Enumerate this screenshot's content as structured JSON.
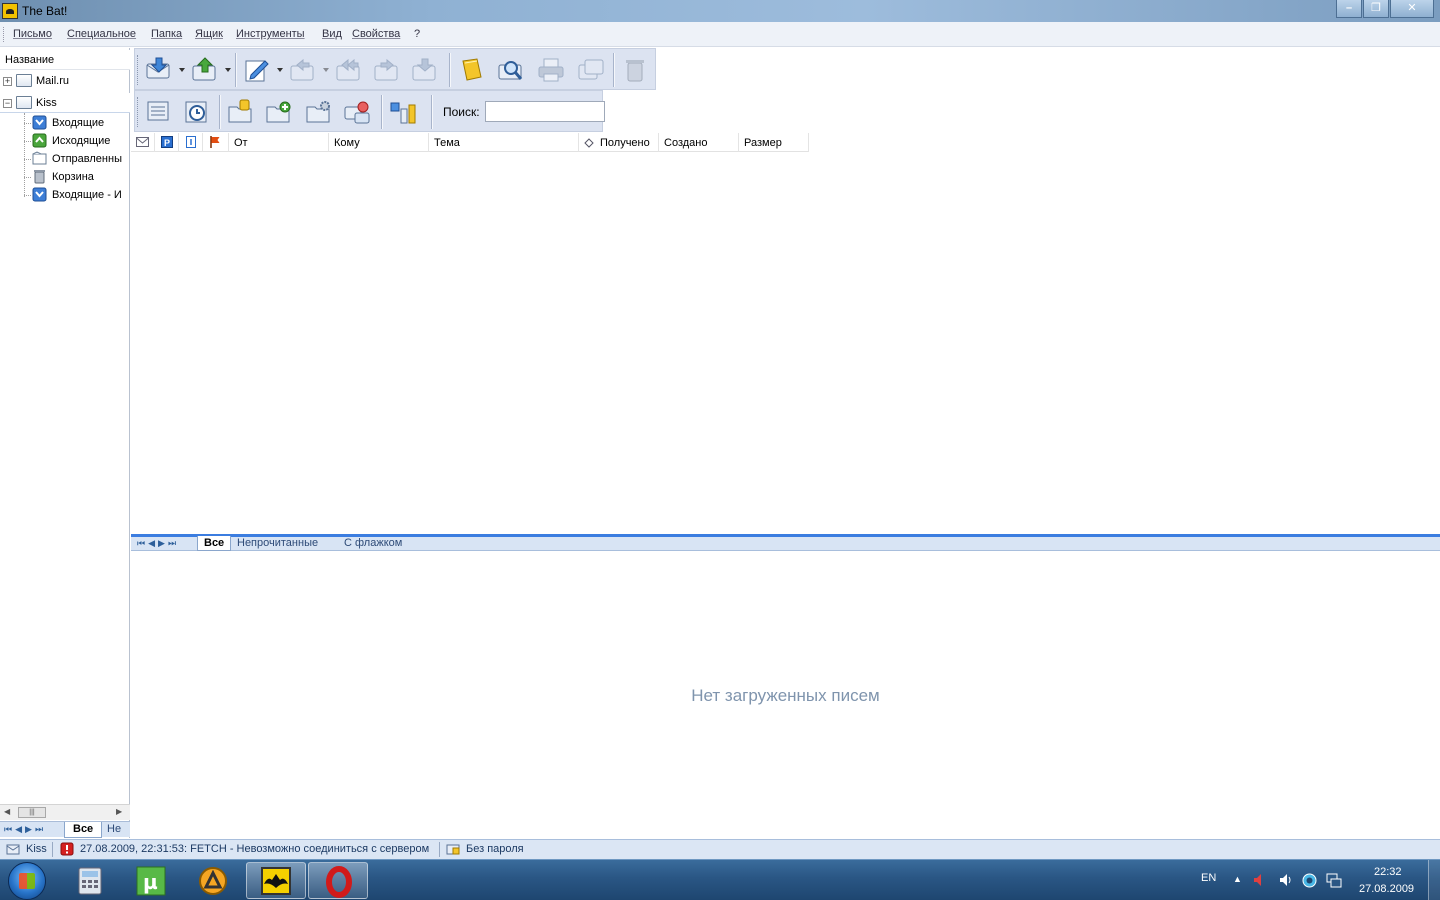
{
  "window": {
    "title": "The Bat!"
  },
  "menu": [
    "Письмо",
    "Специальное",
    "Папка",
    "Ящик",
    "Инструменты",
    "Вид",
    "Свойства",
    "?"
  ],
  "folders": {
    "header": "Название",
    "accounts": [
      {
        "name": "Mail.ru",
        "expanded": false
      },
      {
        "name": "Kiss",
        "expanded": true,
        "children": [
          "Входящие",
          "Исходящие",
          "Отправленны",
          "Корзина",
          "Входящие - И"
        ]
      }
    ],
    "tabs": {
      "all": "Все",
      "other": "Не г"
    }
  },
  "toolbar": {
    "search_label": "Поиск:",
    "search_value": ""
  },
  "columns": [
    "От",
    "Кому",
    "Тема",
    "Получено",
    "Создано",
    "Размер"
  ],
  "filter_tabs": [
    "Все",
    "Непрочитанные",
    "С флажком"
  ],
  "preview": {
    "empty_text": "Нет загруженных писем"
  },
  "status": {
    "account": "Kiss",
    "message": "27.08.2009, 22:31:53: FETCH - Невозможно соединиться с сервером",
    "auth": "Без пароля"
  },
  "taskbar": {
    "lang": "EN",
    "time": "22:32",
    "date": "27.08.2009"
  },
  "colors": {
    "accent": "#3b7de0",
    "toolbar_bg": "#dce3f1",
    "error": "#d42020"
  }
}
